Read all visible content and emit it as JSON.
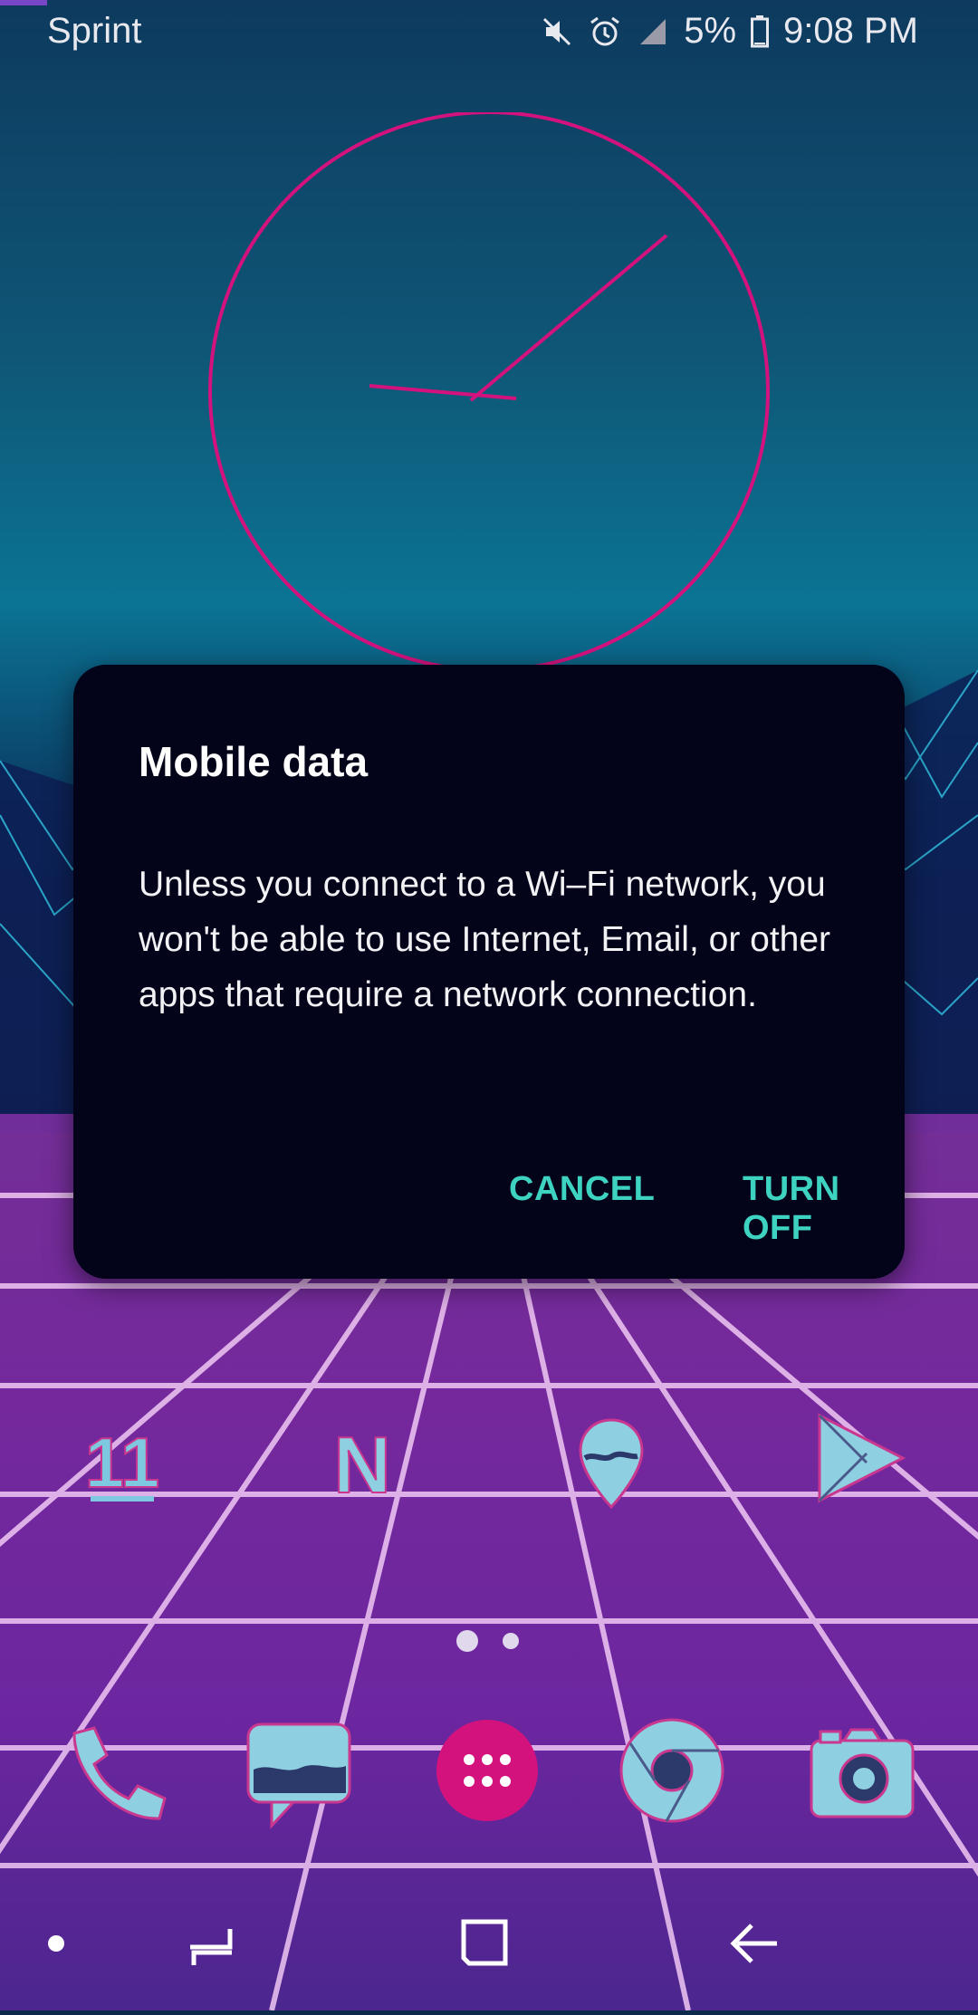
{
  "status_bar": {
    "carrier": "Sprint",
    "battery_percent": "5%",
    "time": "9:08 PM",
    "icons": [
      "mute-icon",
      "alarm-icon",
      "signal-icon",
      "battery-icon"
    ]
  },
  "clock_widget": {
    "type": "analog",
    "accent_color": "#d4127e"
  },
  "dialog": {
    "title": "Mobile data",
    "message": "Unless you connect to a Wi–Fi network, you won't be able to use Internet, Email, or other apps that require a network connection.",
    "cancel_label": "CANCEL",
    "confirm_label": "TURN OFF",
    "accent_color": "#3ed2c0",
    "background_color": "#03031a"
  },
  "home_apps": [
    {
      "icon": "calendar-icon",
      "badge_text": "11"
    },
    {
      "icon": "netflix-icon",
      "badge_text": "N"
    },
    {
      "icon": "maps-icon"
    },
    {
      "icon": "play-store-icon"
    }
  ],
  "page_indicator": {
    "pages": 2,
    "current": 1
  },
  "dock": [
    {
      "icon": "phone-icon"
    },
    {
      "icon": "messages-icon"
    },
    {
      "icon": "app-drawer-icon"
    },
    {
      "icon": "chrome-icon"
    },
    {
      "icon": "camera-icon"
    }
  ],
  "nav_bar": {
    "icons": [
      "dot-indicator-icon",
      "recents-icon",
      "home-icon",
      "back-icon"
    ]
  }
}
